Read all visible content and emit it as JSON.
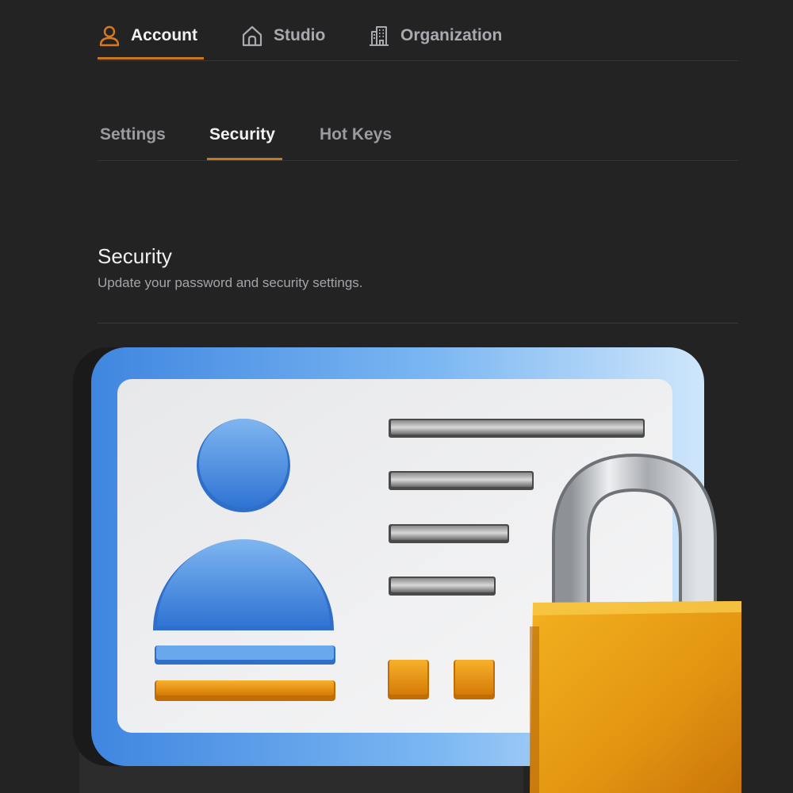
{
  "top_tabs": [
    {
      "label": "Account",
      "icon": "user-icon",
      "active": true
    },
    {
      "label": "Studio",
      "icon": "home-icon",
      "active": false
    },
    {
      "label": "Organization",
      "icon": "building-icon",
      "active": false
    }
  ],
  "sub_tabs": [
    {
      "label": "Settings",
      "active": false
    },
    {
      "label": "Security",
      "active": true
    },
    {
      "label": "Hot Keys",
      "active": false
    }
  ],
  "section": {
    "title": "Security",
    "description": "Update your password and security settings."
  },
  "illustration": {
    "name": "id-card-with-padlock",
    "icons": [
      "id-card-icon",
      "padlock-icon"
    ]
  },
  "colors": {
    "accent": "#c9761f",
    "background": "#232323",
    "card_blue": "#5aa0ec",
    "lock_gold": "#e59a10"
  }
}
